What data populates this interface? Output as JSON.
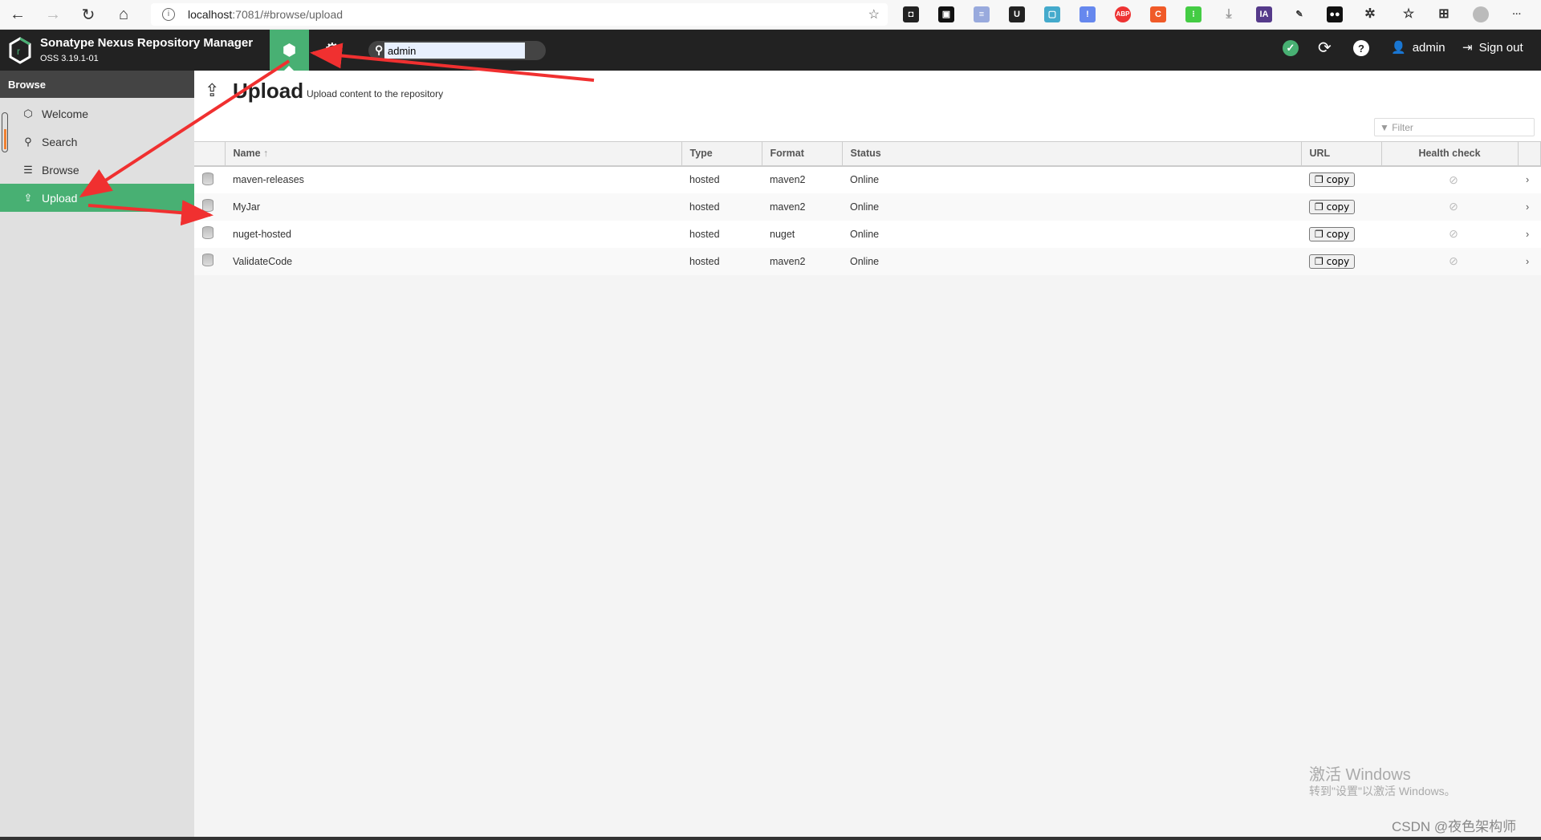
{
  "browser": {
    "url_host": "localhost",
    "url_path": ":7081/#browse/upload"
  },
  "app": {
    "title": "Sonatype Nexus Repository Manager",
    "version": "OSS 3.19.1-01",
    "search_value": "admin",
    "user": "admin",
    "signout": "Sign out",
    "accent": "#48b073"
  },
  "sidebar": {
    "heading": "Browse",
    "items": [
      {
        "label": "Welcome",
        "icon": "hexagon-icon"
      },
      {
        "label": "Search",
        "icon": "search-icon"
      },
      {
        "label": "Browse",
        "icon": "database-icon"
      },
      {
        "label": "Upload",
        "icon": "upload-icon",
        "active": true
      }
    ]
  },
  "page": {
    "title": "Upload",
    "subtitle": "Upload content to the repository",
    "filter_placeholder": "Filter"
  },
  "table": {
    "columns": [
      "Name",
      "Type",
      "Format",
      "Status",
      "URL",
      "Health check"
    ],
    "copy_label": "copy",
    "rows": [
      {
        "name": "maven-releases",
        "type": "hosted",
        "format": "maven2",
        "status": "Online"
      },
      {
        "name": "MyJar",
        "type": "hosted",
        "format": "maven2",
        "status": "Online"
      },
      {
        "name": "nuget-hosted",
        "type": "hosted",
        "format": "nuget",
        "status": "Online"
      },
      {
        "name": "ValidateCode",
        "type": "hosted",
        "format": "maven2",
        "status": "Online"
      }
    ]
  },
  "watermark": {
    "line1": "激活 Windows",
    "line2": "转到\"设置\"以激活 Windows。",
    "csdn": "CSDN @夜色架构师"
  }
}
